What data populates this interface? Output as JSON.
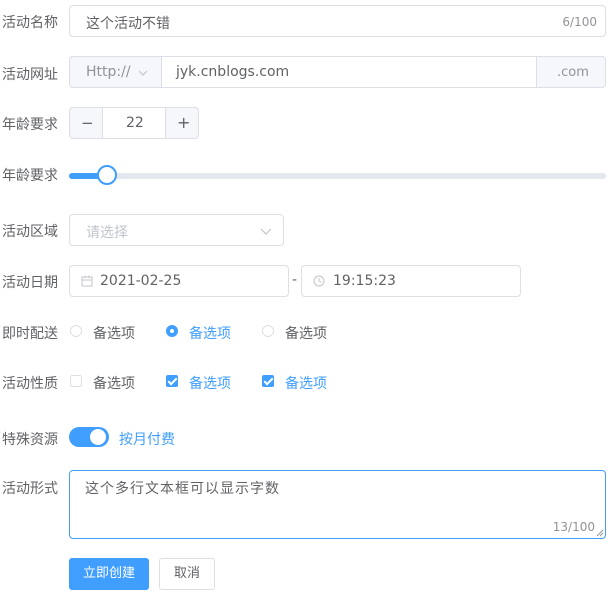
{
  "form": {
    "name": {
      "label": "活动名称",
      "value": "这个活动不错",
      "count": "6/100"
    },
    "url": {
      "label": "活动网址",
      "protocol": "Http://",
      "value": "jyk.cnblogs.com",
      "suffix": ".com"
    },
    "age_stepper": {
      "label": "年龄要求",
      "minus": "−",
      "value": "22",
      "plus": "+"
    },
    "age_slider": {
      "label": "年龄要求",
      "level_percent": 7
    },
    "region": {
      "label": "活动区域",
      "placeholder": "请选择"
    },
    "date": {
      "label": "活动日期",
      "date_value": "2021-02-25",
      "separator": "-",
      "time_value": "19:15:23"
    },
    "delivery": {
      "label": "即时配送",
      "options": [
        {
          "label": "备选项",
          "selected": false
        },
        {
          "label": "备选项",
          "selected": true
        },
        {
          "label": "备选项",
          "selected": false
        }
      ]
    },
    "nature": {
      "label": "活动性质",
      "options": [
        {
          "label": "备选项",
          "checked": false
        },
        {
          "label": "备选项",
          "checked": true
        },
        {
          "label": "备选项",
          "checked": true
        }
      ]
    },
    "resource": {
      "label": "特殊资源",
      "switch_on": true,
      "switch_label": "按月付费"
    },
    "form_text": {
      "label": "活动形式",
      "value": "这个多行文本框可以显示字数",
      "count": "13/100"
    },
    "buttons": {
      "create": "立即创建",
      "cancel": "取消"
    }
  },
  "colors": {
    "primary": "#409eff",
    "border": "#dcdfe6",
    "text": "#606266",
    "placeholder": "#c0c4cc"
  }
}
